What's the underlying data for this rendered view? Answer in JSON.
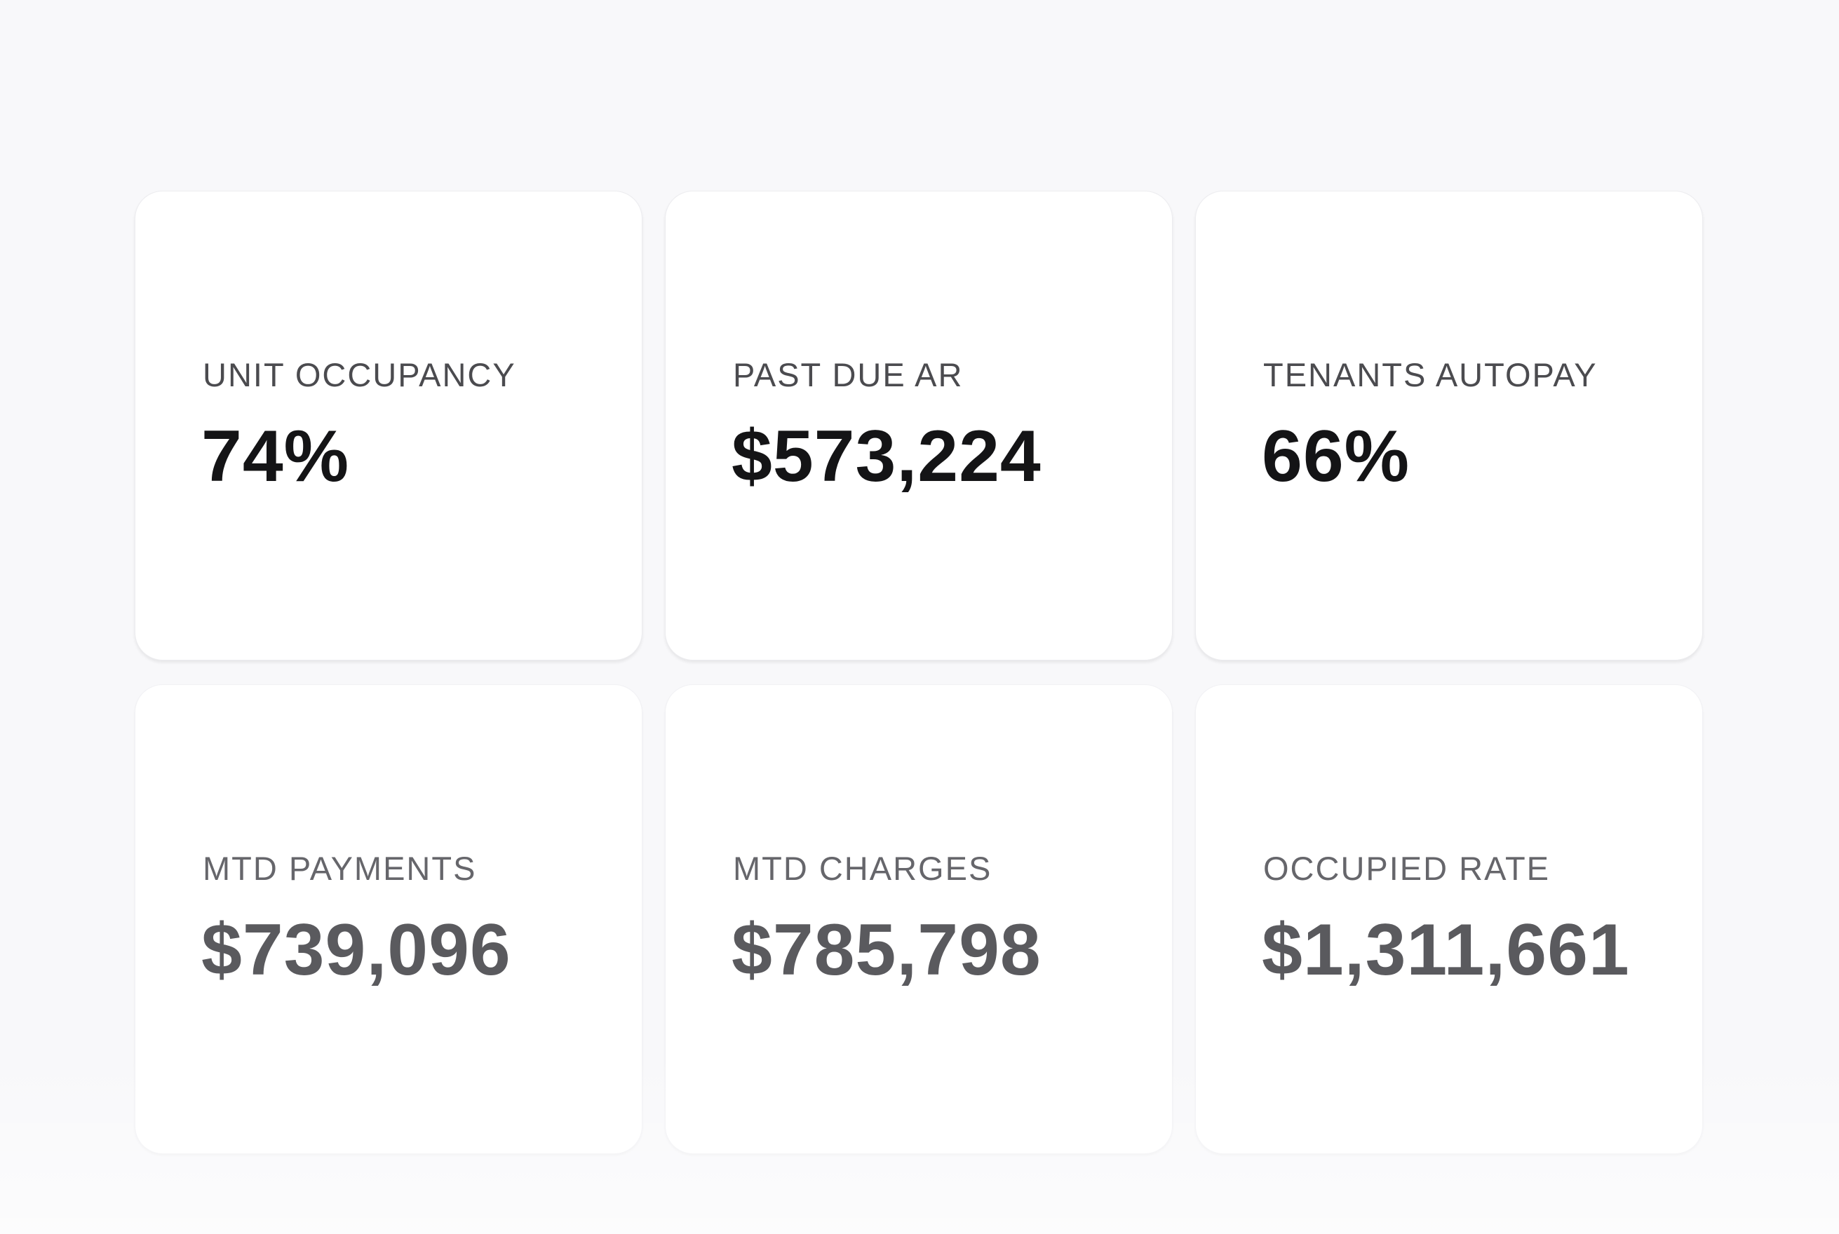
{
  "metrics": [
    {
      "label": "UNIT OCCUPANCY",
      "value": "74%"
    },
    {
      "label": "PAST DUE AR",
      "value": "$573,224"
    },
    {
      "label": "TENANTS AUTOPAY",
      "value": "66%"
    },
    {
      "label": "MTD PAYMENTS",
      "value": "$739,096"
    },
    {
      "label": "MTD CHARGES",
      "value": "$785,798"
    },
    {
      "label": "OCCUPIED RATE",
      "value": "$1,311,661"
    }
  ],
  "colors": {
    "background": "#f8f8fa",
    "card": "#ffffff",
    "label": "#4b4b4f",
    "value": "#141416",
    "value_faded": "#5a5a5e"
  }
}
